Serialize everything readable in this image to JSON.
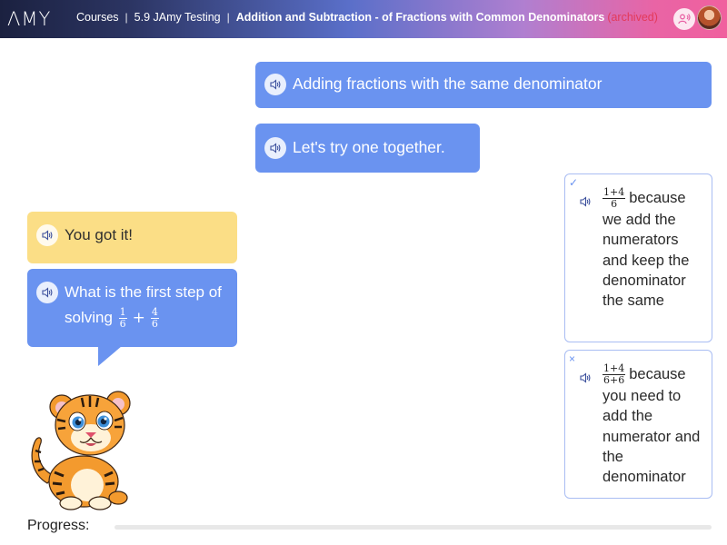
{
  "header": {
    "logo": "ΛMY",
    "breadcrumbs": [
      {
        "label": "Courses"
      },
      {
        "label": "5.9 JAmy Testing"
      },
      {
        "label": "Addition and Subtraction - of Fractions with Common Denominators",
        "status": "(archived)"
      }
    ],
    "icons": [
      "voice-icon",
      "user-avatar"
    ]
  },
  "chat": {
    "tutor_messages": [
      {
        "text": "Adding fractions with the same denominator",
        "icon": "speaker-icon"
      },
      {
        "text": "Let's try one together.",
        "icon": "speaker-icon"
      }
    ],
    "feedback": {
      "text": "You got it!",
      "icon": "speaker-icon"
    },
    "question": {
      "text": "What is the first step of solving",
      "expr": {
        "a_num": "1",
        "a_den": "6",
        "op": "+",
        "b_num": "4",
        "b_den": "6"
      },
      "icon": "speaker-icon"
    }
  },
  "answers": [
    {
      "state": "correct",
      "mark": "✓",
      "frac_num": "1+4",
      "frac_den": "6",
      "text": "because we add the numerators and keep the denominator the same"
    },
    {
      "state": "incorrect",
      "mark": "×",
      "frac_num": "1+4",
      "frac_den": "6+6",
      "text": "because you need to add the numerator and the denominator"
    }
  ],
  "progress": {
    "label": "Progress:",
    "value": 0.0
  },
  "colors": {
    "accent": "#6a93f0",
    "feedback_yellow": "#fbde86",
    "archived": "#e33a5a"
  }
}
